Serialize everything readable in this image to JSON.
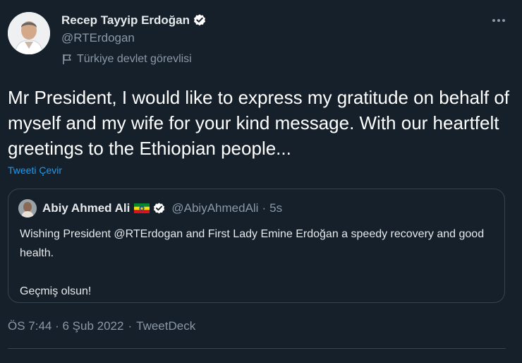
{
  "author": {
    "display_name": "Recep Tayyip Erdoğan",
    "handle": "@RTErdogan",
    "label": "Türkiye devlet görevlisi",
    "verified": true
  },
  "tweet": {
    "text": "Mr President, I would like to express my gratitude on behalf of myself and my wife for your kind message. With our heartfelt greetings to the Ethiopian people...",
    "translate_link": "Tweeti Çevir",
    "timestamp": "ÖS 7:44 · 6 Şub 2022",
    "source": "TweetDeck"
  },
  "quoted_tweet": {
    "display_name": "Abiy Ahmed Ali",
    "handle": "@AbiyAhmedAli",
    "time": "5s",
    "line1": "Wishing President @RTErdogan and First Lady Emine Erdoğan a speedy recovery and good health.",
    "line2": "Geçmiş olsun!"
  },
  "colors": {
    "background": "#15202b",
    "accent": "#1d9bf0",
    "muted": "#8b98a5",
    "border": "#38444d"
  },
  "icons": {
    "verified": "verified-badge-icon",
    "label": "flag-icon",
    "more": "more-options-icon"
  }
}
